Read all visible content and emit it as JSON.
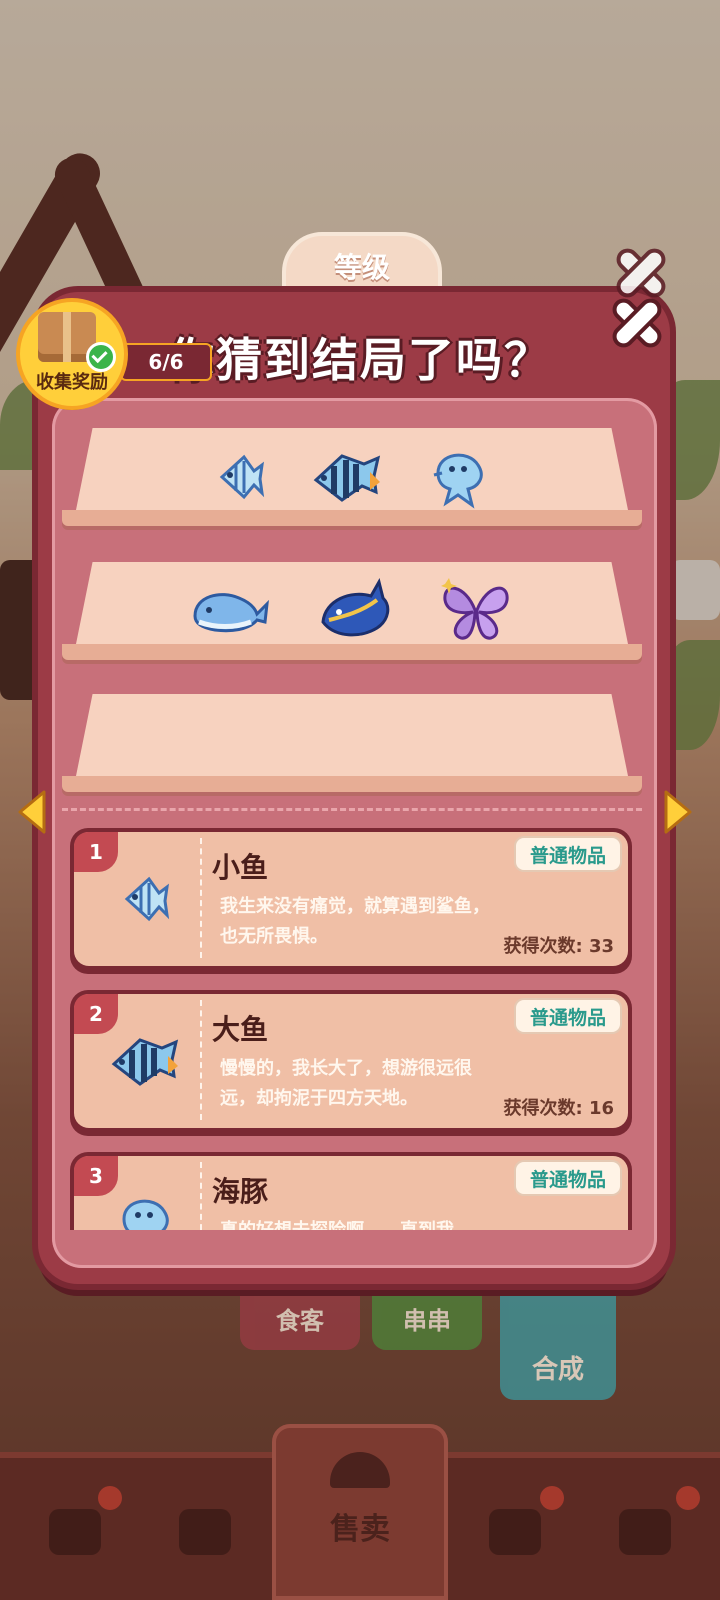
{
  "modal": {
    "title": "你猜到结局了吗？",
    "level_label": "等级"
  },
  "collect_reward": {
    "label": "收集奖励",
    "progress": "6/6"
  },
  "shelves": [
    {
      "items": [
        "small-fish-icon",
        "big-fish-icon",
        "dolphin-icon"
      ]
    },
    {
      "items": [
        "whale-icon",
        "blue-whale-icon",
        "butterfly-icon"
      ]
    },
    {
      "items": []
    }
  ],
  "items": [
    {
      "num": "1",
      "name": "小鱼",
      "tag": "普通物品",
      "desc": "我生来没有痛觉，就算遇到鲨鱼，也无所畏惧。",
      "count": "获得次数: 33",
      "icon": "small-fish-icon"
    },
    {
      "num": "2",
      "name": "大鱼",
      "tag": "普通物品",
      "desc": "慢慢的，我长大了，想游很远很远，却拘泥于四方天地。",
      "count": "获得次数: 16",
      "icon": "big-fish-icon"
    },
    {
      "num": "3",
      "name": "海豚",
      "tag": "普通物品",
      "desc": "真的好想去探险啊……直到我",
      "count": "",
      "icon": "dolphin-icon"
    }
  ],
  "background_tabs": {
    "left": "食客",
    "middle": "串串",
    "right": "合成"
  },
  "bottom_nav": {
    "sell_label": "售卖"
  },
  "colors": {
    "modal_frame": "#9c3b46",
    "modal_inner": "#c8707a",
    "card_face": "#f0bfa6",
    "tag_text": "#2a9a8c"
  }
}
